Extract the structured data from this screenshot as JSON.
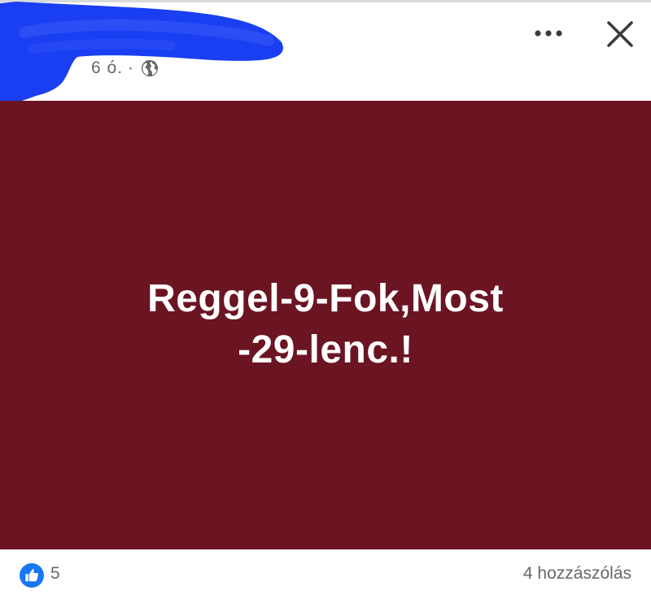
{
  "post": {
    "time": "6 ó.",
    "separator": "·",
    "privacy_icon": "globe-icon",
    "text_line1": "Reggel-9-Fok,Most",
    "text_line2": "-29-lenc.!",
    "background_color": "#6b1422"
  },
  "header": {
    "more_icon": "more-icon",
    "close_icon": "close-icon"
  },
  "footer": {
    "like_icon": "like-icon",
    "likes": "5",
    "comments": "4 hozzászólás"
  },
  "colors": {
    "redaction": "#1a3ff2",
    "meta_text": "#65676b",
    "like_blue": "#1877f2"
  }
}
